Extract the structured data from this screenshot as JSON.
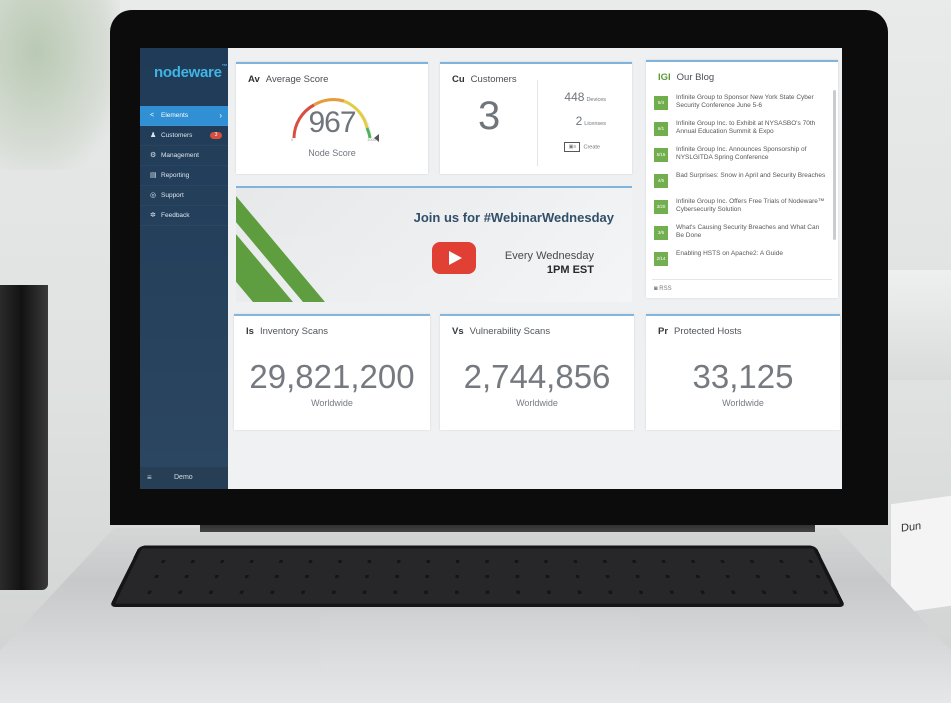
{
  "environment": {
    "paper_text": "Dun"
  },
  "sidebar": {
    "logo": "nodeware",
    "logo_sup": "™",
    "items": [
      {
        "label": "Elements",
        "icon": "share-icon",
        "active": true
      },
      {
        "label": "Customers",
        "icon": "users-icon",
        "badge": "3"
      },
      {
        "label": "Management",
        "icon": "gears-icon"
      },
      {
        "label": "Reporting",
        "icon": "report-icon"
      },
      {
        "label": "Support",
        "icon": "lifebuoy-icon"
      },
      {
        "label": "Feedback",
        "icon": "gear-icon"
      }
    ],
    "footer_icon": "hamburger-icon",
    "footer_label": "Demo"
  },
  "avg_score": {
    "abbr": "Av",
    "title": "Average Score",
    "value": "967",
    "label": "Node Score",
    "min": "0",
    "max": "1000",
    "gauge_fraction": 0.967
  },
  "customers": {
    "abbr": "Cu",
    "title": "Customers",
    "count": "3",
    "devices_value": "448",
    "devices_label": "Devices",
    "licenses_value": "2",
    "licenses_label": "Licenses",
    "create_label": "Create"
  },
  "banner": {
    "headline": "Join us for #WebinarWednesday",
    "line1": "Every Wednesday",
    "line2": "1PM EST"
  },
  "blog": {
    "abbr": "IGI",
    "title": "Our Blog",
    "posts": [
      {
        "date": "6/4",
        "title": "Infinite Group to Sponsor New York State Cyber Security Conference June 5-6"
      },
      {
        "date": "6/1",
        "title": "Infinite Group Inc. to Exhibit at NYSASBO's 70th Annual Education Summit & Expo"
      },
      {
        "date": "5/15",
        "title": "Infinite Group Inc. Announces Sponsorship of NYSLGITDA Spring Conference"
      },
      {
        "date": "4/6",
        "title": "Bad Surprises: Snow in April and Security Breaches"
      },
      {
        "date": "3/20",
        "title": "Infinite Group Inc. Offers Free Trials of Nodeware™ Cybersecurity Solution"
      },
      {
        "date": "3/6",
        "title": "What's Causing Security Breaches and What Can Be Done"
      },
      {
        "date": "2/14",
        "title": "Enabling HSTS on Apache2: A Guide"
      }
    ],
    "rss": "RSS"
  },
  "stats": [
    {
      "abbr": "Is",
      "title": "Inventory Scans",
      "value": "29,821,200",
      "label": "Worldwide"
    },
    {
      "abbr": "Vs",
      "title": "Vulnerability Scans",
      "value": "2,744,856",
      "label": "Worldwide"
    },
    {
      "abbr": "Pr",
      "title": "Protected Hosts",
      "value": "33,125",
      "label": "Worldwide"
    }
  ],
  "colors": {
    "sidebar": "#1f3b57",
    "active": "#2f8fd3",
    "accent_green": "#5a9b3a",
    "card_border": "#7fb3dc"
  }
}
